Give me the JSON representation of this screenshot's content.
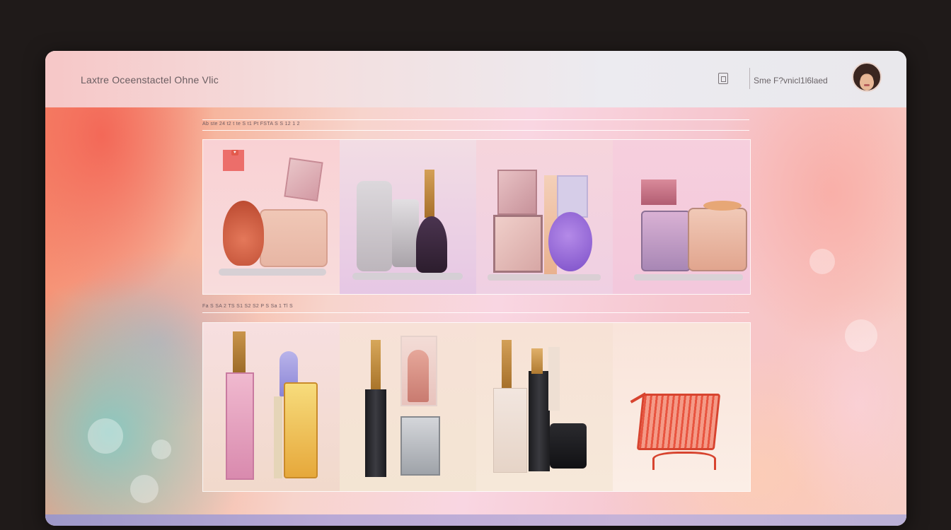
{
  "header": {
    "site_title": "Laxtre Oceenstactel Ohne Vlic",
    "user_label": "Sme  F?vnicl1l6laed",
    "icon": "bookmark-icon",
    "avatar": "user-avatar"
  },
  "sections": [
    {
      "heading": "Ab  ste 24 t2 t  te  S t1 Pt  FSTA S  S 12  1 2",
      "cards": [
        {
          "name": "heart-compact-set",
          "icon": "heart-icon"
        },
        {
          "name": "serum-bottle-set"
        },
        {
          "name": "compact-palette-set"
        },
        {
          "name": "vanity-jar-set"
        }
      ]
    },
    {
      "heading": "Fa  S  SA 2  TS  S1 S2 S2  P  S  Sa  1  Tl  S",
      "cards": [
        {
          "name": "perfume-bottle-set"
        },
        {
          "name": "lipstick-set"
        },
        {
          "name": "foundation-set"
        },
        {
          "name": "shopping-cart-card",
          "icon": "shopping-cart-icon"
        }
      ]
    }
  ],
  "colors": {
    "accent": "#e35a4c",
    "header_bg": "#f4dede",
    "bottom_bar": "#b9a9d6"
  }
}
